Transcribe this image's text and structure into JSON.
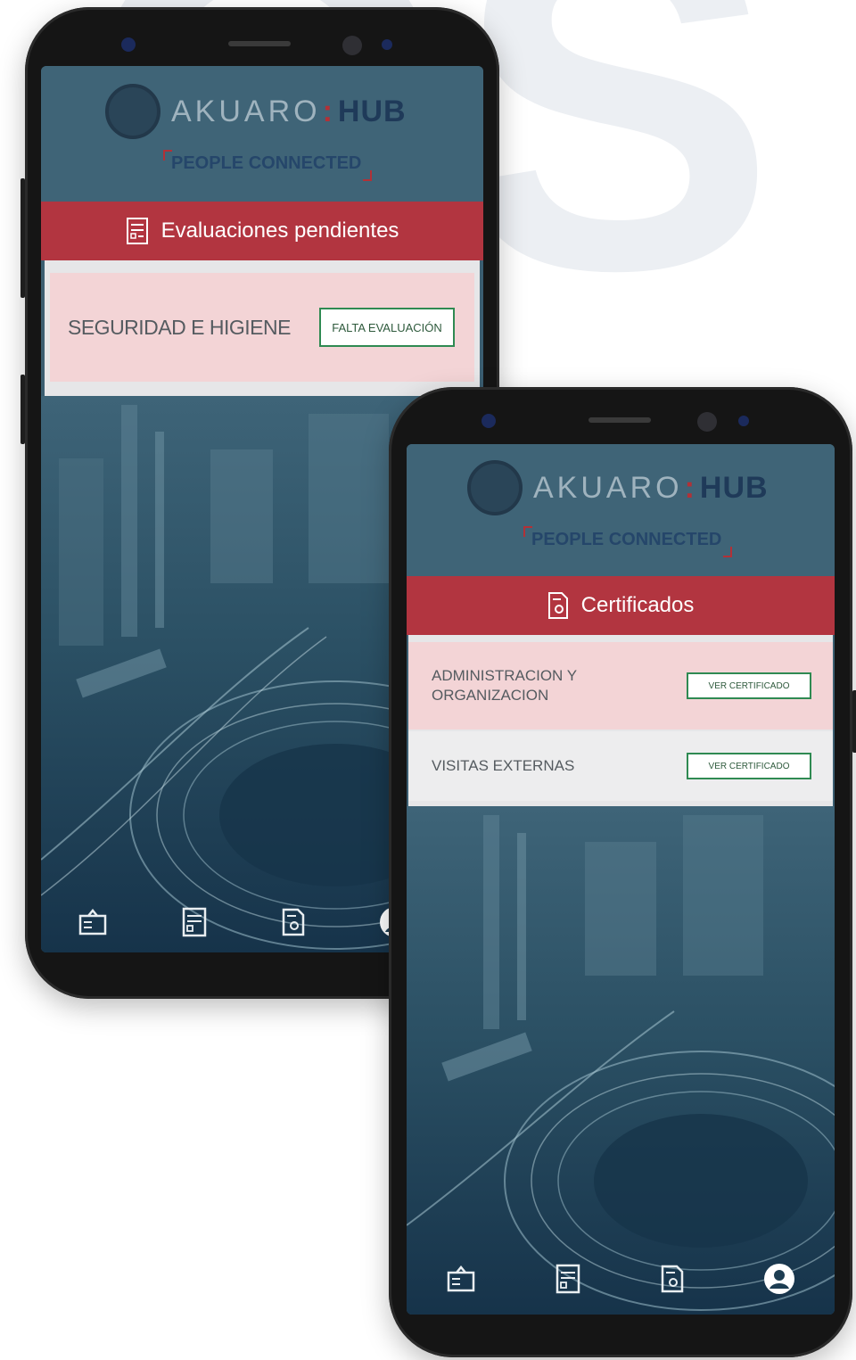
{
  "colors": {
    "primary_header": "#3f6477",
    "banner_red": "#b23540",
    "card_pink": "#f3d4d6",
    "button_border_green": "#2f8a52",
    "brand_navy": "#1f3a59",
    "background_letters": "#eceff3"
  },
  "background": {
    "letters": "OS"
  },
  "phone_left": {
    "brand": {
      "name_left": "AKUARO",
      "separator": ":",
      "name_right": "HUB",
      "tagline": "PEOPLE CONNECTED"
    },
    "section": {
      "icon": "evaluation-form-icon",
      "title": "Evaluaciones pendientes"
    },
    "items": [
      {
        "course": "SEGURIDAD E HIGIENE",
        "action": "FALTA EVALUACIÓN"
      }
    ],
    "nav": [
      {
        "icon": "training-board-icon"
      },
      {
        "icon": "evaluation-form-icon"
      },
      {
        "icon": "certificate-icon"
      },
      {
        "icon": "user-profile-icon"
      }
    ]
  },
  "phone_right": {
    "brand": {
      "name_left": "AKUARO",
      "separator": ":",
      "name_right": "HUB",
      "tagline": "PEOPLE CONNECTED"
    },
    "section": {
      "icon": "certificate-icon",
      "title": "Certificados"
    },
    "items": [
      {
        "course_line1": "ADMINISTRACION Y",
        "course_line2": "ORGANIZACION",
        "action": "VER CERTIFICADO"
      },
      {
        "course": "VISITAS EXTERNAS",
        "action": "VER CERTIFICADO"
      }
    ],
    "nav": [
      {
        "icon": "training-board-icon"
      },
      {
        "icon": "evaluation-form-icon"
      },
      {
        "icon": "certificate-icon"
      },
      {
        "icon": "user-profile-icon"
      }
    ]
  }
}
